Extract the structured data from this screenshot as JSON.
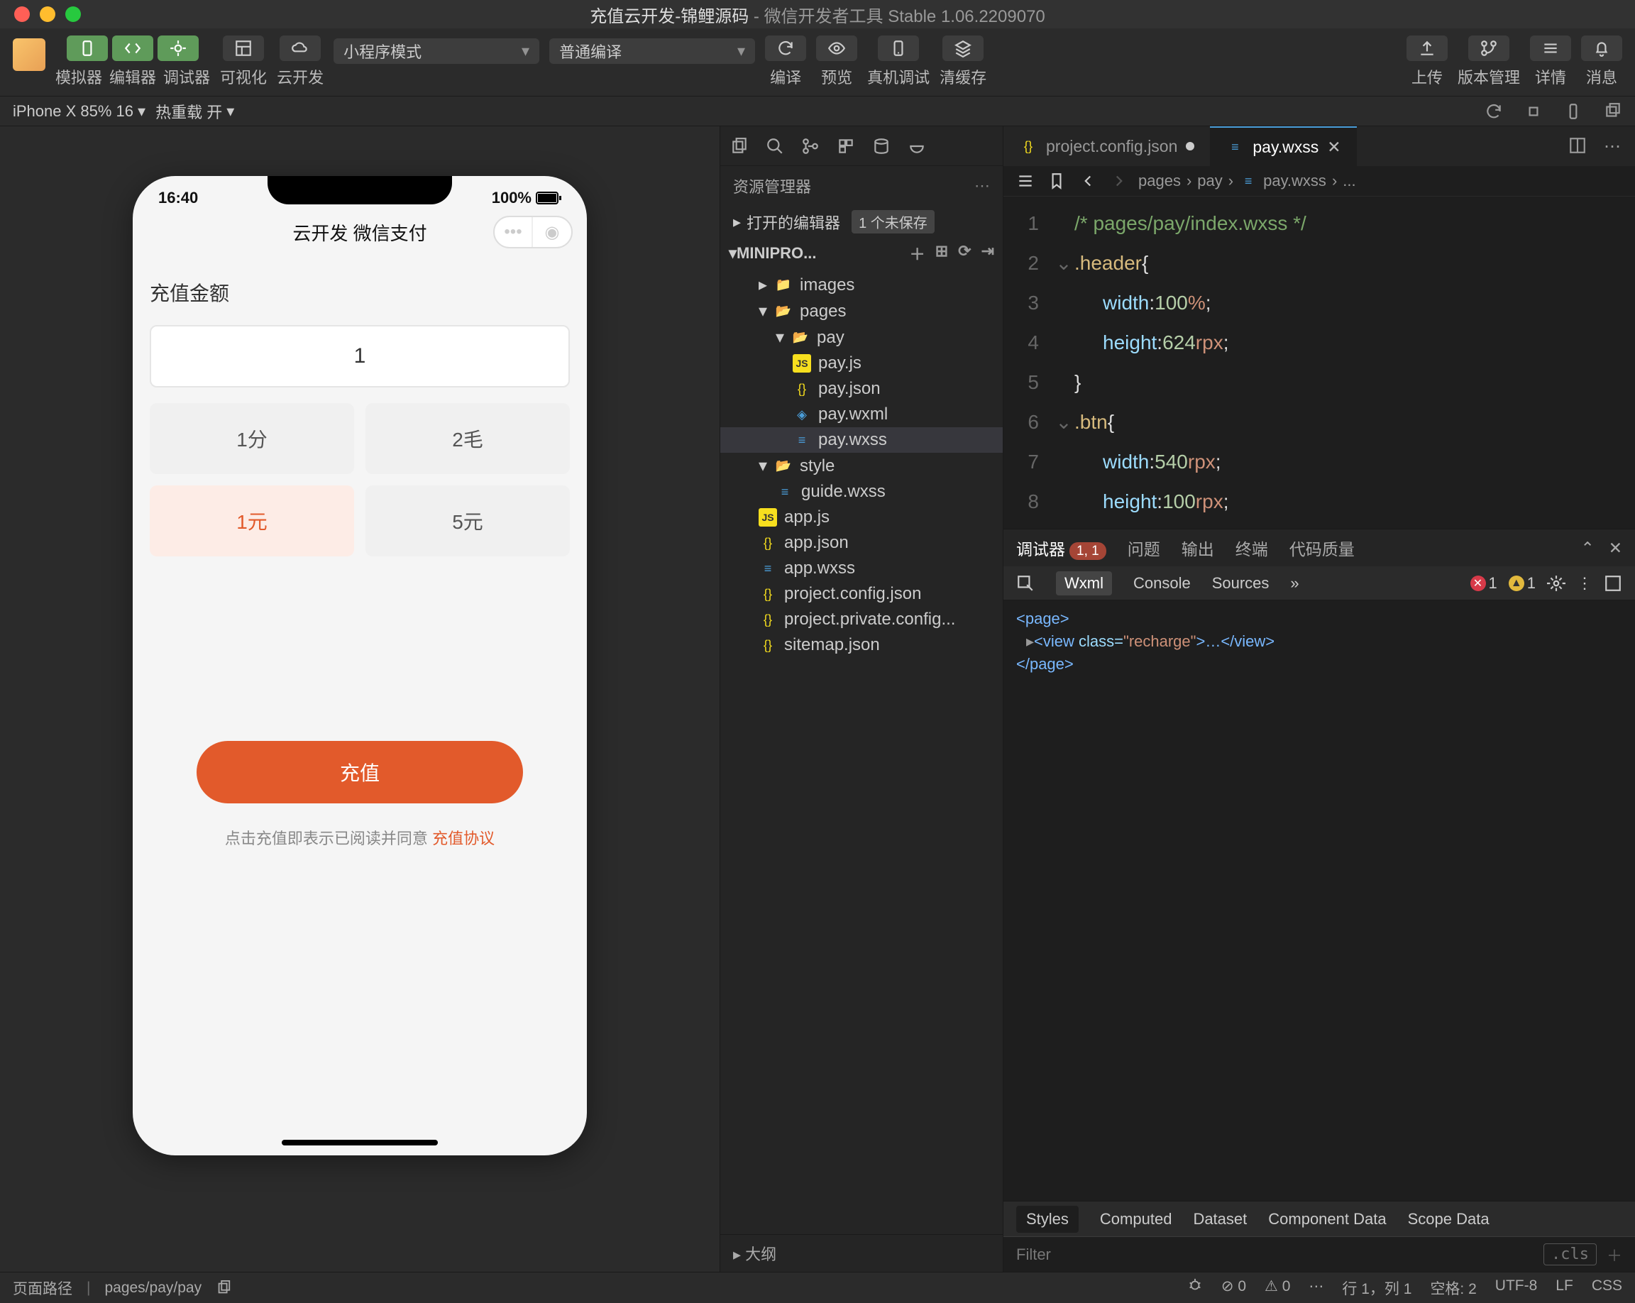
{
  "titlebar": {
    "project": "充值云开发-锦鲤源码",
    "suffix": " - 微信开发者工具 Stable 1.06.2209070"
  },
  "toolbar": {
    "view_labels": [
      "模拟器",
      "编辑器",
      "调试器"
    ],
    "vis_label": "可视化",
    "cloud_label": "云开发",
    "mode_dd": "小程序模式",
    "compile_dd": "普通编译",
    "compile_label": "编译",
    "preview_label": "预览",
    "remote_label": "真机调试",
    "clear_label": "清缓存",
    "upload_label": "上传",
    "version_label": "版本管理",
    "detail_label": "详情",
    "msg_label": "消息"
  },
  "subbar": {
    "device": "iPhone X 85% 16",
    "dd2": "热重载 开"
  },
  "explorer": {
    "title": "资源管理器",
    "open_editors": "打开的编辑器",
    "unsaved_badge": "1 个未保存",
    "project_name": "MINIPRO...",
    "tree": {
      "images": "images",
      "pages": "pages",
      "pay": "pay",
      "pay_js": "pay.js",
      "pay_json": "pay.json",
      "pay_wxml": "pay.wxml",
      "pay_wxss": "pay.wxss",
      "style": "style",
      "guide": "guide.wxss",
      "app_js": "app.js",
      "app_json": "app.json",
      "app_wxss": "app.wxss",
      "proj_conf": "project.config.json",
      "proj_priv": "project.private.config...",
      "sitemap": "sitemap.json"
    },
    "outline": "大纲"
  },
  "tabs": {
    "t1": "project.config.json",
    "t2": "pay.wxss"
  },
  "crumbs": {
    "a": "pages",
    "b": "pay",
    "c": "pay.wxss",
    "d": "..."
  },
  "code": {
    "l1": "/* pages/pay/index.wxss */",
    "l2a": ".header",
    "l2b": "{",
    "l3a": "width",
    "l3b": ":",
    "l3c": "100",
    "l3d": "%",
    "l3e": ";",
    "l4a": "height",
    "l4b": ":",
    "l4c": "624",
    "l4d": "rpx",
    "l4e": ";",
    "l5": "}",
    "l6a": ".btn",
    "l6b": "{",
    "l7a": "width",
    "l7b": ":",
    "l7c": "540",
    "l7d": "rpx",
    "l7e": ";",
    "l8a": "height",
    "l8b": ": ",
    "l8c": "100",
    "l8d": "rpx",
    "l8e": ";"
  },
  "dbg": {
    "tab_dbg": "调试器",
    "tab_cnt": "1, 1",
    "tab_prob": "问题",
    "tab_out": "输出",
    "tab_term": "终端",
    "tab_qual": "代码质量",
    "sub_wxml": "Wxml",
    "sub_console": "Console",
    "sub_src": "Sources",
    "err_n": "1",
    "warn_n": "1",
    "page_open": "<page>",
    "view": "<view ",
    "cls": "class=",
    "valq": "\"recharge\"",
    "rest": ">…</view>",
    "page_close": "</page>",
    "styles": "Styles",
    "computed": "Computed",
    "dataset": "Dataset",
    "compdata": "Component Data",
    "scopedata": "Scope Data",
    "filter": "Filter",
    "cls_btn": ".cls"
  },
  "status": {
    "path_lbl": "页面路径",
    "path_val": "pages/pay/pay",
    "err_n": "0",
    "warn_n": "0",
    "pos": "行 1，列 1",
    "space": "空格: 2",
    "enc": "UTF-8",
    "eol": "LF",
    "lang": "CSS"
  },
  "sim": {
    "time": "16:40",
    "battery": "100%",
    "nav_title": "云开发 微信支付",
    "sec_title": "充值金额",
    "amount": "1",
    "p1": "1分",
    "p2": "2毛",
    "p3": "1元",
    "p4": "5元",
    "btn": "充值",
    "agree_a": "点击充值即表示已阅读并同意",
    "agree_b": "充值协议"
  }
}
